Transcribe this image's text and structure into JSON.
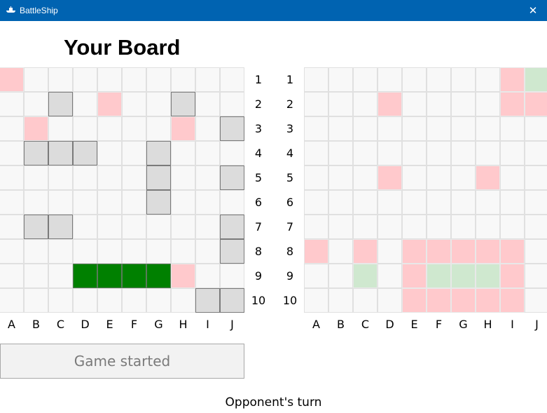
{
  "window": {
    "title": "BattleShip",
    "close_label": "✕",
    "app_icon": "battleship-icon"
  },
  "player_board": {
    "title": "Your Board",
    "columns": [
      "A",
      "B",
      "C",
      "D",
      "E",
      "F",
      "G",
      "H",
      "I",
      "J"
    ],
    "rows": [
      "1",
      "2",
      "3",
      "4",
      "5",
      "6",
      "7",
      "8",
      "9",
      "10"
    ],
    "cells": [
      {
        "col": "A",
        "row": "1",
        "state": "miss"
      },
      {
        "col": "C",
        "row": "2",
        "state": "ship"
      },
      {
        "col": "E",
        "row": "2",
        "state": "miss"
      },
      {
        "col": "H",
        "row": "2",
        "state": "ship"
      },
      {
        "col": "B",
        "row": "3",
        "state": "miss"
      },
      {
        "col": "H",
        "row": "3",
        "state": "miss"
      },
      {
        "col": "J",
        "row": "3",
        "state": "ship"
      },
      {
        "col": "B",
        "row": "4",
        "state": "ship"
      },
      {
        "col": "C",
        "row": "4",
        "state": "ship"
      },
      {
        "col": "D",
        "row": "4",
        "state": "ship"
      },
      {
        "col": "G",
        "row": "4",
        "state": "ship"
      },
      {
        "col": "G",
        "row": "5",
        "state": "ship"
      },
      {
        "col": "J",
        "row": "5",
        "state": "ship"
      },
      {
        "col": "G",
        "row": "6",
        "state": "ship"
      },
      {
        "col": "B",
        "row": "7",
        "state": "ship"
      },
      {
        "col": "C",
        "row": "7",
        "state": "ship"
      },
      {
        "col": "J",
        "row": "7",
        "state": "ship"
      },
      {
        "col": "J",
        "row": "8",
        "state": "ship"
      },
      {
        "col": "D",
        "row": "9",
        "state": "sunk"
      },
      {
        "col": "E",
        "row": "9",
        "state": "sunk"
      },
      {
        "col": "F",
        "row": "9",
        "state": "sunk"
      },
      {
        "col": "G",
        "row": "9",
        "state": "sunk"
      },
      {
        "col": "H",
        "row": "9",
        "state": "miss"
      },
      {
        "col": "I",
        "row": "10",
        "state": "ship"
      },
      {
        "col": "J",
        "row": "10",
        "state": "ship"
      }
    ]
  },
  "opponent_board": {
    "columns": [
      "A",
      "B",
      "C",
      "D",
      "E",
      "F",
      "G",
      "H",
      "I",
      "J"
    ],
    "rows": [
      "1",
      "2",
      "3",
      "4",
      "5",
      "6",
      "7",
      "8",
      "9",
      "10"
    ],
    "cells": [
      {
        "col": "I",
        "row": "1",
        "state": "miss"
      },
      {
        "col": "J",
        "row": "1",
        "state": "hit"
      },
      {
        "col": "D",
        "row": "2",
        "state": "miss"
      },
      {
        "col": "I",
        "row": "2",
        "state": "miss"
      },
      {
        "col": "J",
        "row": "2",
        "state": "miss"
      },
      {
        "col": "D",
        "row": "5",
        "state": "miss"
      },
      {
        "col": "H",
        "row": "5",
        "state": "miss"
      },
      {
        "col": "A",
        "row": "8",
        "state": "miss"
      },
      {
        "col": "C",
        "row": "8",
        "state": "miss"
      },
      {
        "col": "E",
        "row": "8",
        "state": "miss"
      },
      {
        "col": "F",
        "row": "8",
        "state": "miss"
      },
      {
        "col": "G",
        "row": "8",
        "state": "miss"
      },
      {
        "col": "H",
        "row": "8",
        "state": "miss"
      },
      {
        "col": "I",
        "row": "8",
        "state": "miss"
      },
      {
        "col": "C",
        "row": "9",
        "state": "hit"
      },
      {
        "col": "E",
        "row": "9",
        "state": "miss"
      },
      {
        "col": "F",
        "row": "9",
        "state": "hit"
      },
      {
        "col": "G",
        "row": "9",
        "state": "hit"
      },
      {
        "col": "H",
        "row": "9",
        "state": "hit"
      },
      {
        "col": "I",
        "row": "9",
        "state": "miss"
      },
      {
        "col": "E",
        "row": "10",
        "state": "miss"
      },
      {
        "col": "F",
        "row": "10",
        "state": "miss"
      },
      {
        "col": "G",
        "row": "10",
        "state": "miss"
      },
      {
        "col": "H",
        "row": "10",
        "state": "miss"
      },
      {
        "col": "I",
        "row": "10",
        "state": "miss"
      }
    ]
  },
  "status_button": {
    "label": "Game started"
  },
  "turn_status": "Opponent's turn",
  "colors": {
    "titlebar": "#0063b1",
    "empty": "#f8f8f8",
    "ship": "#dcdcdc",
    "miss": "#ffc9cc",
    "hit": "#cfe8cf",
    "sunk": "#008000"
  }
}
